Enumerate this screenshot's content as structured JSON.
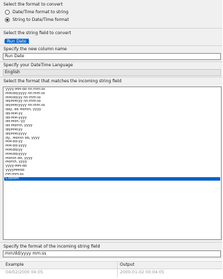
{
  "format_section": {
    "label": "Select the format to convert",
    "options": [
      {
        "label": "Date/Time format to string",
        "selected": false
      },
      {
        "label": "String to Date/Time format",
        "selected": true
      }
    ]
  },
  "string_field": {
    "label": "Select the string field to convert",
    "value": "Run Date"
  },
  "new_column": {
    "label": "Specify the new column name",
    "value": "Run Date"
  },
  "language": {
    "label": "Specify your DateTime Language",
    "value": "English"
  },
  "format_list": {
    "label": "Select the format that matches the incoming string field",
    "items": [
      "yyyy-MM-dd hh:mm:ss",
      "MM/dd/yyyy hh:mm:ss",
      "MM/dd/yy hh:mm:ss",
      "dd/MM/yy hh:mm:ss",
      "dd/MM/yyyy hh:mm:ss",
      "day, dd Month, yyyy",
      "dd-MM-yy",
      "dd-MM-yyyy",
      "dd-Mon.-yy",
      "dd Month, yyyy",
      "dd/MM/yy",
      "dd/MM/yyyy",
      "dy., Month dd, yyyy",
      "MM-dd-yy",
      "MM-dd-yyyy",
      "MM/dd/yy",
      "MM/dd/yyyy",
      "Month dd, yyyy",
      "Month, yyyy",
      "yyyy-MM-dd",
      "yyyyMMdd",
      "HH:mm:ss",
      "Custom"
    ],
    "selected_index": 22
  },
  "incoming_format": {
    "label": "Specify the format of the incoming string field",
    "value": "mm/dd/yyyy mm:ss"
  },
  "preview": {
    "headers": [
      "Example",
      "Output"
    ],
    "row": [
      "04/02/2000 04:05",
      "2000-01-02 00:04:05"
    ]
  }
}
